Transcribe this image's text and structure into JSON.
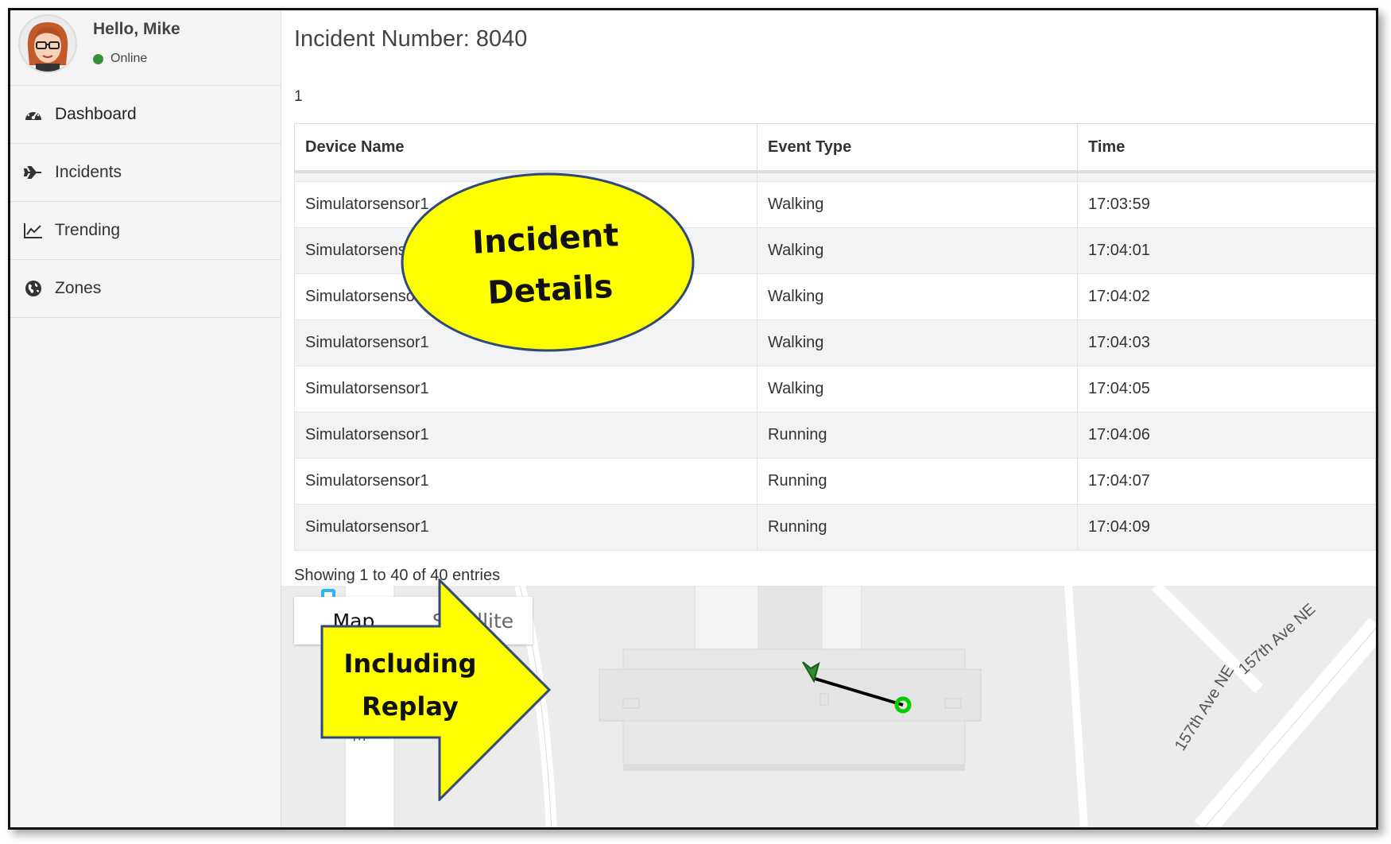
{
  "user": {
    "greeting": "Hello, Mike",
    "status": "Online",
    "status_color": "#3a8f3a"
  },
  "nav": [
    {
      "label": "Dashboard",
      "icon": "dashboard-icon"
    },
    {
      "label": "Incidents",
      "icon": "plane-icon"
    },
    {
      "label": "Trending",
      "icon": "line-chart-icon"
    },
    {
      "label": "Zones",
      "icon": "globe-icon"
    }
  ],
  "page": {
    "title": "Incident Number: 8040",
    "page_number": "1"
  },
  "table": {
    "columns": [
      "Device Name",
      "Event Type",
      "Time"
    ],
    "rows": [
      [
        "Simulatorsensor1",
        "Walking",
        "17:03:59"
      ],
      [
        "Simulatorsensor1",
        "Walking",
        "17:04:01"
      ],
      [
        "Simulatorsensor1",
        "Walking",
        "17:04:02"
      ],
      [
        "Simulatorsensor1",
        "Walking",
        "17:04:03"
      ],
      [
        "Simulatorsensor1",
        "Walking",
        "17:04:05"
      ],
      [
        "Simulatorsensor1",
        "Running",
        "17:04:06"
      ],
      [
        "Simulatorsensor1",
        "Running",
        "17:04:07"
      ],
      [
        "Simulatorsensor1",
        "Running",
        "17:04:09"
      ]
    ],
    "info": "Showing 1 to 40 of 40 entries"
  },
  "map": {
    "toggle": {
      "map_label": "Map",
      "satellite_label": "Satellite"
    },
    "road_label_1": "157th Ave NE",
    "road_label_2": "157th Ave NE",
    "road_label_3": "E"
  },
  "callouts": {
    "oval": {
      "line1": "Incident",
      "line2": "Details",
      "color": "#ffff00"
    },
    "arrow": {
      "line1": "Including",
      "line2": "Replay",
      "color": "#ffff00"
    }
  }
}
